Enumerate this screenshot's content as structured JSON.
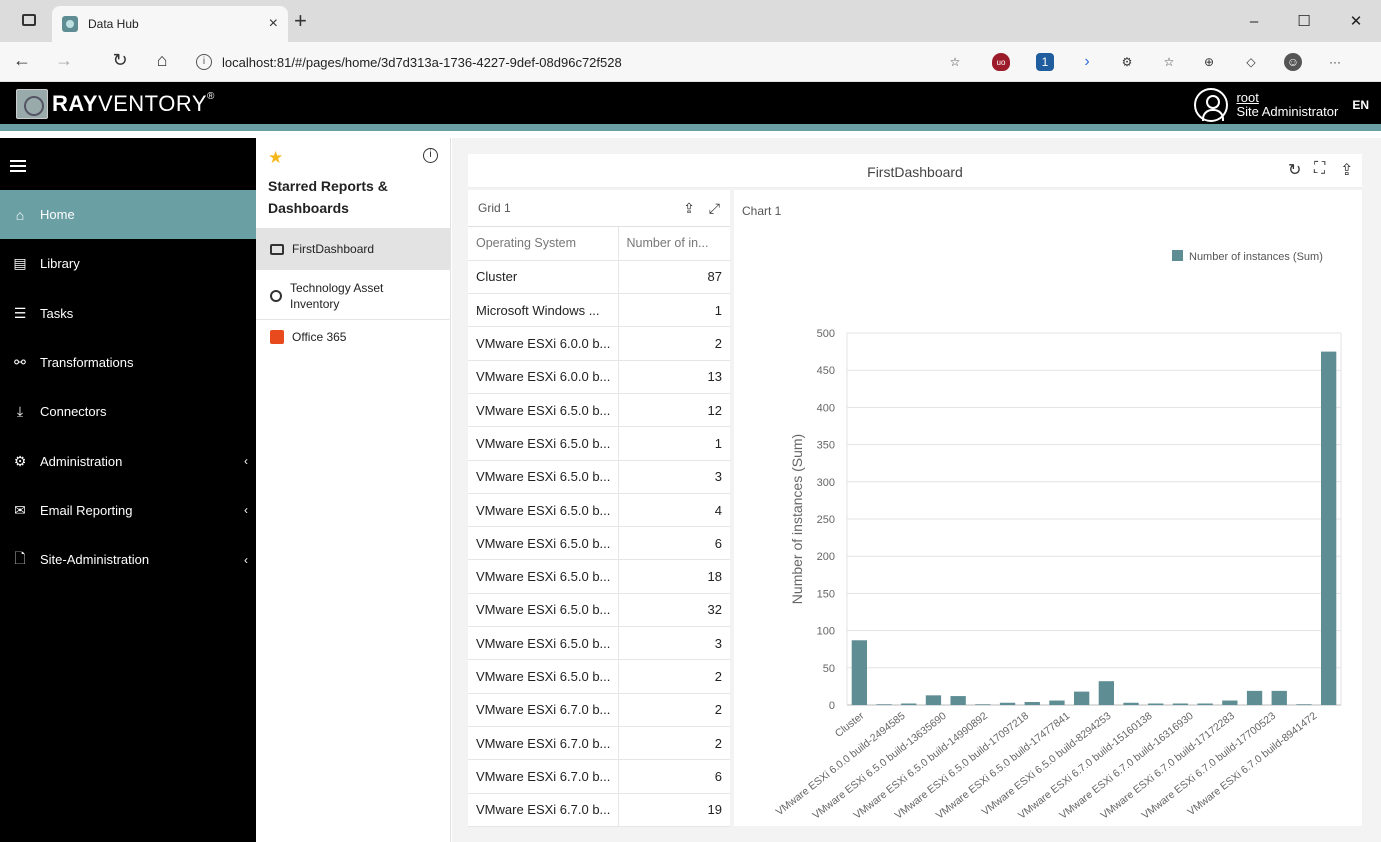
{
  "browser": {
    "tab_title": "Data Hub",
    "tab_close": "×",
    "new_tab": "+",
    "url": "localhost:81/#/pages/home/3d7d313a-1736-4227-9def-08d96c72f528",
    "win_minimize": "–",
    "win_maximize": "☐",
    "win_close": "✕",
    "back": "←",
    "forward": "→",
    "reload": "↻",
    "home": "⌂",
    "more": "···"
  },
  "app": {
    "logo_bold": "RAY",
    "logo_rest": "VENTORY",
    "user_name": "root",
    "user_role": "Site Administrator",
    "language": "EN"
  },
  "nav": {
    "items": [
      {
        "label": "Home",
        "icon": "home-icon",
        "glyph": "⌂",
        "active": true,
        "chevron": ""
      },
      {
        "label": "Library",
        "icon": "library-icon",
        "glyph": "▤",
        "active": false,
        "chevron": ""
      },
      {
        "label": "Tasks",
        "icon": "tasks-icon",
        "glyph": "☰",
        "active": false,
        "chevron": ""
      },
      {
        "label": "Transformations",
        "icon": "transformations-icon",
        "glyph": "⚯",
        "active": false,
        "chevron": ""
      },
      {
        "label": "Connectors",
        "icon": "connectors-icon",
        "glyph": "⤓",
        "active": false,
        "chevron": ""
      },
      {
        "label": "Administration",
        "icon": "administration-icon",
        "glyph": "⚙",
        "active": false,
        "chevron": "‹"
      },
      {
        "label": "Email Reporting",
        "icon": "email-icon",
        "glyph": "✉",
        "active": false,
        "chevron": "‹"
      },
      {
        "label": "Site-Administration",
        "icon": "site-admin-icon",
        "glyph": "🗋",
        "active": false,
        "chevron": "‹"
      }
    ]
  },
  "starred": {
    "title": "Starred Reports & Dashboards",
    "info": "i",
    "items": [
      {
        "label": "FirstDashboard",
        "icon": "dashboard-icon",
        "active": true
      },
      {
        "label": "Technology Asset Inventory",
        "icon": "gauge-icon",
        "active": false
      },
      {
        "label": "Office 365",
        "icon": "office-icon",
        "active": false
      }
    ]
  },
  "dashboard": {
    "title": "FirstDashboard",
    "grid": {
      "title": "Grid 1",
      "columns": [
        "Operating System",
        "Number of in..."
      ],
      "rows": [
        [
          "Cluster",
          "87"
        ],
        [
          "Microsoft Windows ...",
          "1"
        ],
        [
          "VMware ESXi 6.0.0 b...",
          "2"
        ],
        [
          "VMware ESXi 6.0.0 b...",
          "13"
        ],
        [
          "VMware ESXi 6.5.0 b...",
          "12"
        ],
        [
          "VMware ESXi 6.5.0 b...",
          "1"
        ],
        [
          "VMware ESXi 6.5.0 b...",
          "3"
        ],
        [
          "VMware ESXi 6.5.0 b...",
          "4"
        ],
        [
          "VMware ESXi 6.5.0 b...",
          "6"
        ],
        [
          "VMware ESXi 6.5.0 b...",
          "18"
        ],
        [
          "VMware ESXi 6.5.0 b...",
          "32"
        ],
        [
          "VMware ESXi 6.5.0 b...",
          "3"
        ],
        [
          "VMware ESXi 6.5.0 b...",
          "2"
        ],
        [
          "VMware ESXi 6.7.0 b...",
          "2"
        ],
        [
          "VMware ESXi 6.7.0 b...",
          "2"
        ],
        [
          "VMware ESXi 6.7.0 b...",
          "6"
        ],
        [
          "VMware ESXi 6.7.0 b...",
          "19"
        ]
      ]
    },
    "chart_title": "Chart 1"
  },
  "chart_data": {
    "type": "bar",
    "title": "",
    "xlabel": "",
    "ylabel": "Number of instances (Sum)",
    "ylim": [
      0,
      500
    ],
    "yticks": [
      0,
      50,
      100,
      150,
      200,
      250,
      300,
      350,
      400,
      450,
      500
    ],
    "grid": true,
    "legend": "top-right",
    "color": "#5f8d94",
    "series": [
      {
        "name": "Number of instances (Sum)",
        "values": [
          87,
          1,
          2,
          13,
          12,
          1,
          3,
          4,
          6,
          18,
          32,
          3,
          2,
          2,
          2,
          6,
          19,
          19,
          1,
          475
        ]
      }
    ],
    "tick_labels": [
      "Cluster",
      "VMware ESXi 6.0.0 build-2494585",
      "VMware ESXi 6.5.0 build-13635690",
      "VMware ESXi 6.5.0 build-14990892",
      "VMware ESXi 6.5.0 build-17097218",
      "VMware ESXi 6.5.0 build-17477841",
      "VMware ESXi 6.5.0 build-8294253",
      "VMware ESXi 6.7.0 build-15160138",
      "VMware ESXi 6.7.0 build-16316930",
      "VMware ESXi 6.7.0 build-17172283",
      "VMware ESXi 6.7.0 build-17700523",
      "VMware ESXi 6.7.0 build-8941472"
    ]
  }
}
